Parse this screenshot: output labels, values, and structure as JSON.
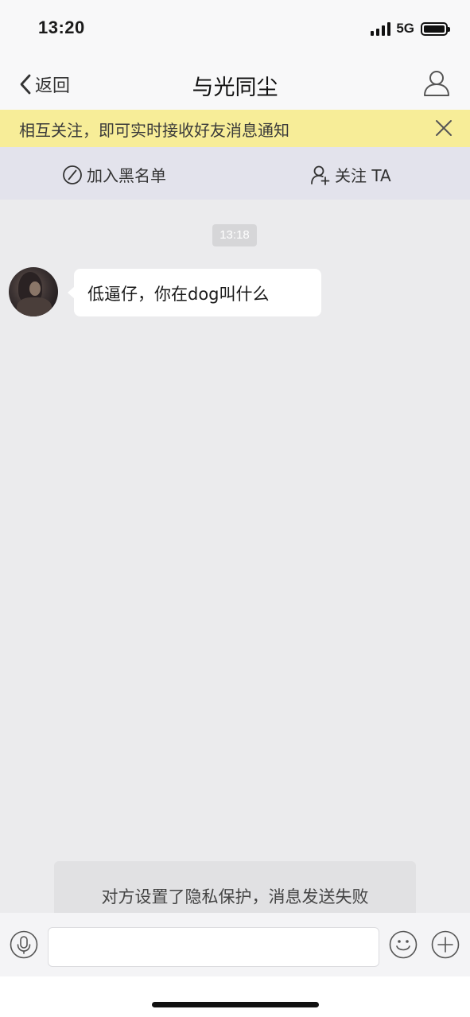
{
  "status_bar": {
    "time": "13:20",
    "network": "5G",
    "signal_icon": "signal-bars-icon",
    "battery_icon": "battery-icon"
  },
  "nav": {
    "back_label": "返回",
    "title": "与光同尘",
    "back_icon": "chevron-left-icon",
    "profile_icon": "person-icon"
  },
  "notice": {
    "text": "相互关注，即可实时接收好友消息通知",
    "close_icon": "close-icon"
  },
  "actions": {
    "block_label": "加入黑名单",
    "follow_label": "关注 TA",
    "block_icon": "block-icon",
    "follow_icon": "add-user-icon"
  },
  "chat": {
    "timestamp": "13:18",
    "messages": [
      {
        "sender": "other",
        "text": "低逼仔，你在dog叫什么"
      }
    ]
  },
  "toast": {
    "text": "对方设置了隐私保护，消息发送失败"
  },
  "input_bar": {
    "value": "",
    "placeholder": "",
    "voice_icon": "microphone-icon",
    "emoji_icon": "smiley-icon",
    "plus_icon": "plus-circle-icon"
  },
  "colors": {
    "notice_bg": "#f7ed98",
    "action_bar_bg": "#e3e3ec",
    "chat_bg": "#ebebed"
  }
}
